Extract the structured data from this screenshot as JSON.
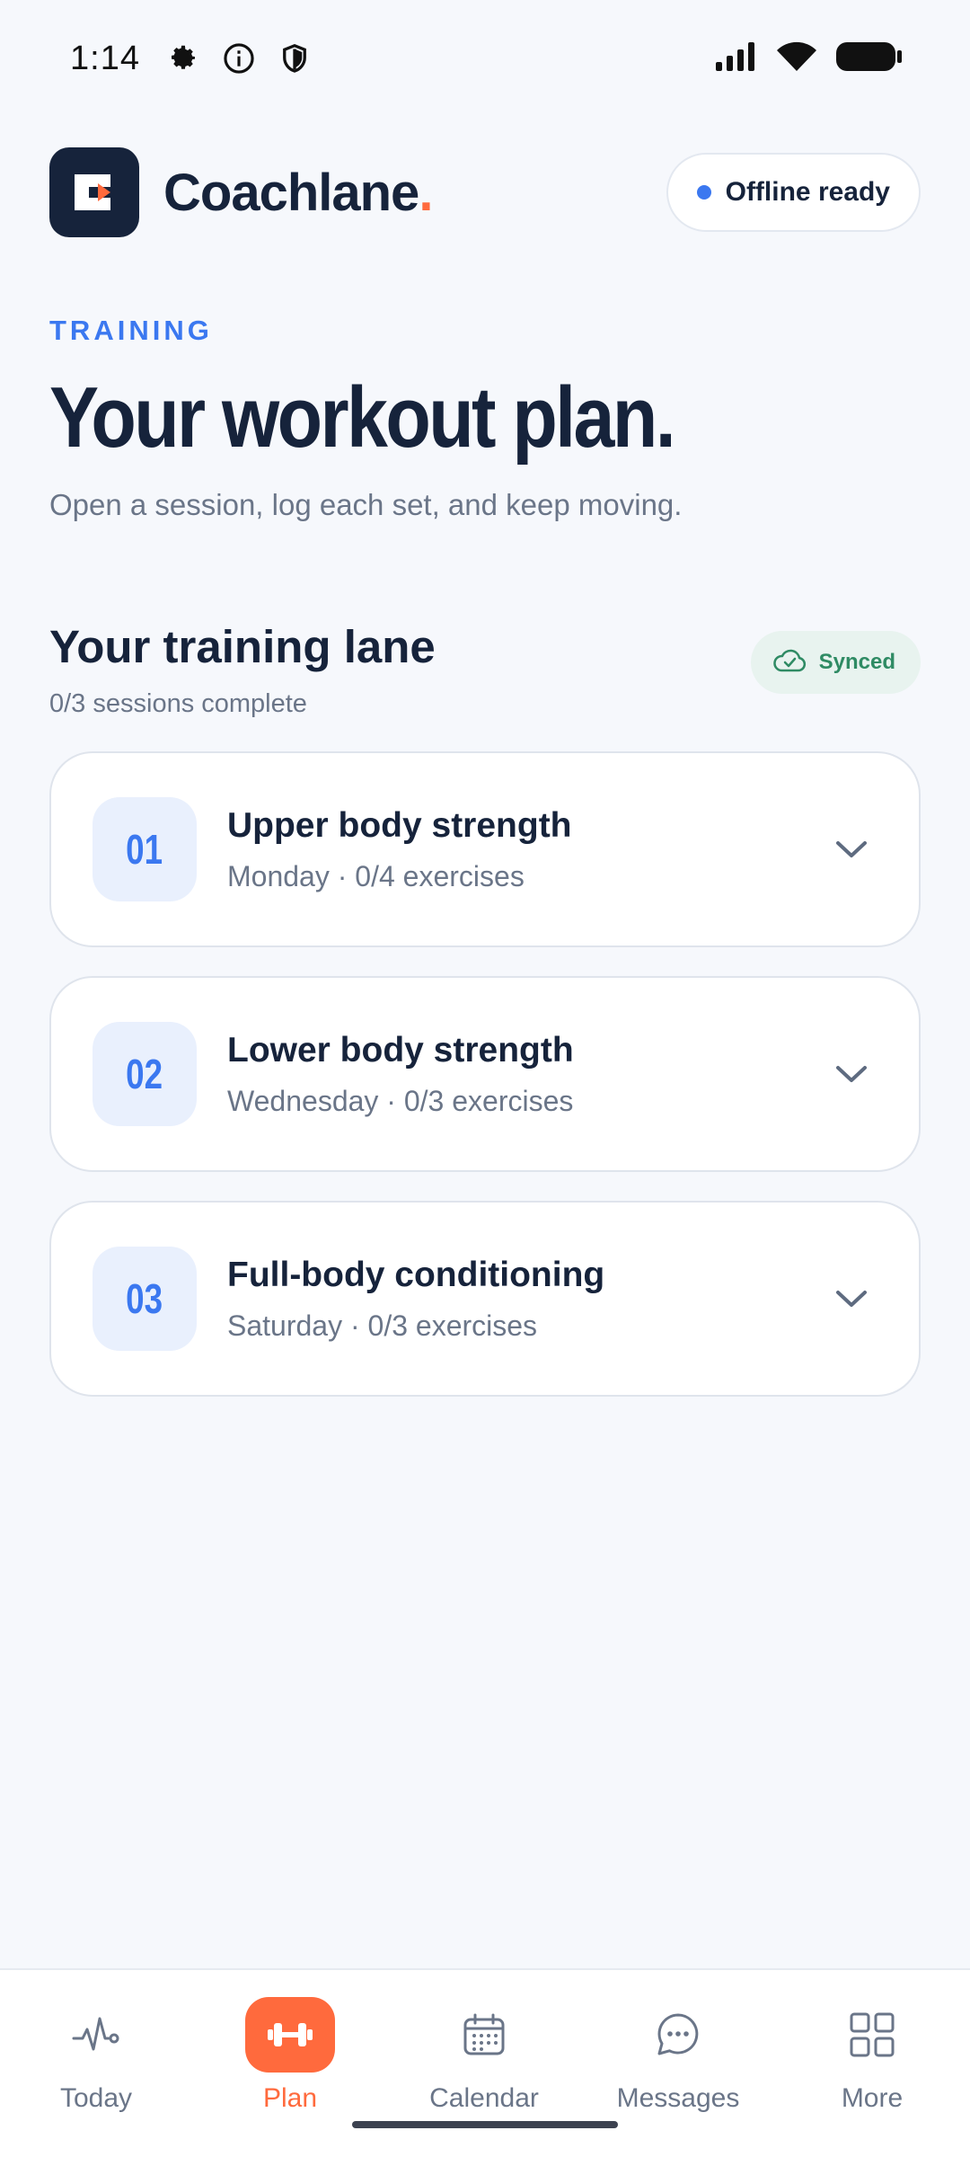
{
  "status_bar": {
    "time": "1:14",
    "left_icons": [
      "gear-icon",
      "info-icon",
      "shield-icon"
    ],
    "right_icons": [
      "signal-icon",
      "wifi-icon",
      "battery-icon"
    ]
  },
  "header": {
    "brand_name": "Coachlane",
    "brand_dot": ".",
    "offline_label": "Offline ready"
  },
  "hero": {
    "eyebrow": "TRAINING",
    "title": "Your workout plan.",
    "subtitle": "Open a session, log each set, and keep moving."
  },
  "section": {
    "title": "Your training lane",
    "count": "0/3 sessions complete",
    "badge": "Synced"
  },
  "sessions": [
    {
      "number": "01",
      "title": "Upper body strength",
      "meta": "Monday · 0/4 exercises"
    },
    {
      "number": "02",
      "title": "Lower body strength",
      "meta": "Wednesday · 0/3 exercises"
    },
    {
      "number": "03",
      "title": "Full-body conditioning",
      "meta": "Saturday · 0/3 exercises"
    }
  ],
  "nav": {
    "active": "Plan",
    "items": [
      {
        "label": "Today",
        "icon": "pulse-icon"
      },
      {
        "label": "Plan",
        "icon": "dumbbell-icon"
      },
      {
        "label": "Calendar",
        "icon": "calendar-icon"
      },
      {
        "label": "Messages",
        "icon": "chat-icon"
      },
      {
        "label": "More",
        "icon": "grid-icon"
      }
    ]
  },
  "colors": {
    "accent": "#ff6a3d",
    "primary": "#16233b",
    "blue": "#3b78f0",
    "success": "#2f8b64",
    "background": "#f6f8fc"
  }
}
